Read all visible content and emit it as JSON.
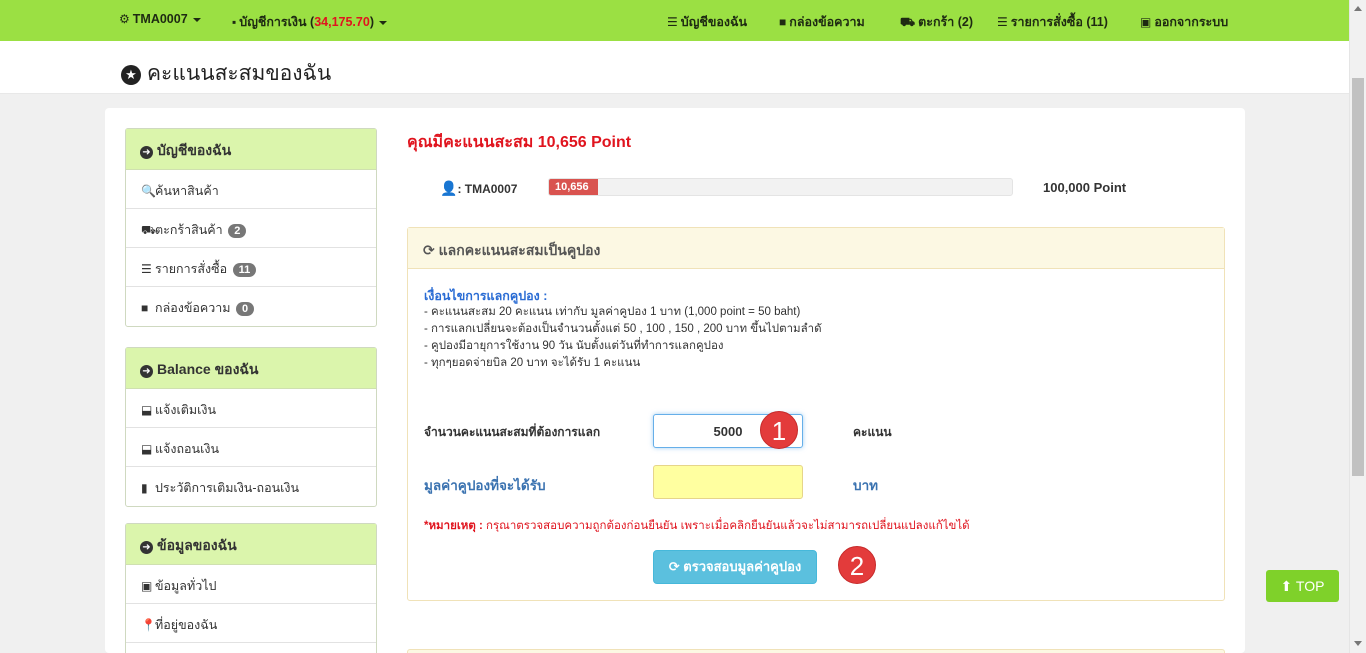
{
  "navbar": {
    "user": "TMA0007",
    "account_label": "บัญชีการเงิน (",
    "account_balance": "34,175.70",
    "account_close": ")",
    "my_account": "บัญชีของฉัน",
    "inbox": "กล่องข้อความ",
    "cart": "ตะกร้า (2)",
    "orders": "รายการสั่งซื้อ (11)",
    "logout": "ออกจากระบบ",
    "icons": [
      "gear-icon",
      "wallet-icon",
      "list-icon",
      "comment-icon",
      "cart-icon",
      "list-icon",
      "lock-icon"
    ]
  },
  "page": {
    "title": "คะแนนสะสมของฉัน"
  },
  "sidebar": {
    "account": {
      "title": "บัญชีของฉัน",
      "items": [
        {
          "label": "ค้นหาสินค้า",
          "badge": ""
        },
        {
          "label": "ตะกร้าสินค้า",
          "badge": "2"
        },
        {
          "label": "รายการสั่งซื้อ",
          "badge": "11"
        },
        {
          "label": "กล่องข้อความ",
          "badge": "0"
        }
      ]
    },
    "balance": {
      "title": "Balance ของฉัน",
      "items": [
        {
          "label": "แจ้งเติมเงิน"
        },
        {
          "label": "แจ้งถอนเงิน"
        },
        {
          "label": "ประวัติการเติมเงิน-ถอนเงิน"
        }
      ]
    },
    "profile": {
      "title": "ข้อมูลของฉัน",
      "items": [
        {
          "label": "ข้อมูลทั่วไป"
        },
        {
          "label": "ที่อยู่ของฉัน"
        }
      ]
    }
  },
  "points": {
    "headline": "คุณมีคะแนนสะสม 10,656 Point",
    "user_label": ": TMA0007",
    "current": "10,656",
    "progress_fraction": 0.10656,
    "max_label": "100,000 Point"
  },
  "exchange": {
    "panel_title": "แลกคะแนนสะสมเป็นคูปอง",
    "conditions_title": "เงื่อนไขการแลกคูปอง :",
    "conditions": [
      "- คะแนนสะสม 20 คะแนน เท่ากับ มูลค่าคูปอง 1 บาท  (1,000 point = 50 baht)",
      "- การแลกเปลี่ยนจะต้องเป็นจำนวนตั้งแต่   50 , 100 , 150 , 200 บาท ขึ้นไปตามลำดั",
      "- คูปองมีอายุการใช้งาน 90 วัน นับตั้งแต่วันที่ทำการแลกคูปอง",
      "- ทุกๆยอดจ่ายบิล 20 บาท จะได้รับ 1 คะแนน"
    ],
    "amount_label": "จำนวนคะแนนสะสมที่ต้องการแลก",
    "amount_value": "5000",
    "amount_unit": "คะแนน",
    "coupon_label": "มูลค่าคูปองที่จะได้รับ",
    "coupon_value": "",
    "coupon_unit": "บาท",
    "remark_prefix": "*หมายเหตุ :",
    "remark_text": " กรุณาตรวจสอบความถูกต้องก่อนยืนยัน เพราะเมื่อคลิกยืนยันแล้วจะไม่สามารถเปลี่ยนแปลงแก้ไขได้",
    "check_button": "ตรวจสอบมูลค่าคูปอง"
  },
  "markers": [
    "1",
    "2"
  ],
  "top_button": "TOP",
  "colors": {
    "navbar": "#9be043",
    "accent_red": "#e0141e",
    "sidebar_head": "#dbf5ac",
    "info_button": "#5bc0de",
    "top_button": "#7fd12a"
  }
}
